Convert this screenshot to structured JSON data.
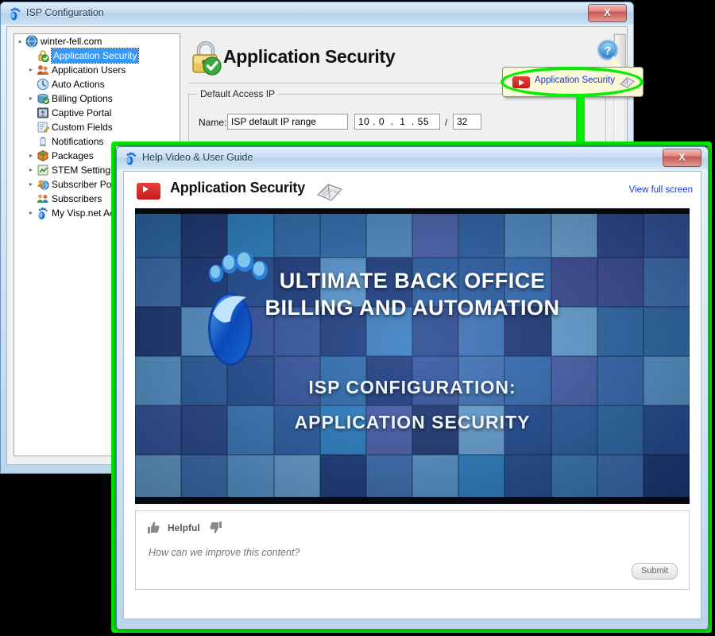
{
  "main_window": {
    "title": "ISP Configuration",
    "icon": "footprint-icon",
    "close_label": "X",
    "tree": [
      {
        "label": "winter-fell.com",
        "icon": "globe-icon",
        "indent": 0,
        "arrow": "▴",
        "selected": false
      },
      {
        "label": "Application Security",
        "icon": "lock-check-icon",
        "indent": 1,
        "arrow": "",
        "selected": true
      },
      {
        "label": "Application Users",
        "icon": "users-icon",
        "indent": 1,
        "arrow": "▸",
        "selected": false
      },
      {
        "label": "Auto Actions",
        "icon": "clock-icon",
        "indent": 1,
        "arrow": "",
        "selected": false
      },
      {
        "label": "Billing Options",
        "icon": "billing-icon",
        "indent": 1,
        "arrow": "▸",
        "selected": false
      },
      {
        "label": "Captive Portal",
        "icon": "portal-icon",
        "indent": 1,
        "arrow": "",
        "selected": false
      },
      {
        "label": "Custom Fields",
        "icon": "pencil-note-icon",
        "indent": 1,
        "arrow": "",
        "selected": false
      },
      {
        "label": "Notifications",
        "icon": "bell-icon",
        "indent": 1,
        "arrow": "",
        "selected": false
      },
      {
        "label": "Packages",
        "icon": "package-icon",
        "indent": 1,
        "arrow": "▸",
        "selected": false
      },
      {
        "label": "STEM Settings",
        "icon": "stem-icon",
        "indent": 1,
        "arrow": "▸",
        "selected": false
      },
      {
        "label": "Subscriber Portal",
        "icon": "subscriber-portal-icon",
        "indent": 1,
        "arrow": "▸",
        "selected": false
      },
      {
        "label": "Subscribers",
        "icon": "subscribers-icon",
        "indent": 1,
        "arrow": "",
        "selected": false
      },
      {
        "label": "My Visp.net Account",
        "icon": "footprint-icon",
        "indent": 1,
        "arrow": "▸",
        "selected": false
      }
    ],
    "page": {
      "title": "Application Security",
      "icon": "lock-check-large-icon",
      "group_legend": "Default Access IP",
      "name_label": "Name:",
      "name_value": "ISP default IP range",
      "ip_value": "10 . 0  .  1  . 55",
      "slash": "/",
      "cidr_value": "32"
    },
    "help_button_icon": "help-question-icon",
    "tooltip": {
      "link_text": "Application Security",
      "video_icon": "youtube-play-icon",
      "guide_icon": "book-icon"
    }
  },
  "help_dialog": {
    "title": "Help Video & User Guide",
    "icon": "footprint-icon",
    "close_label": "X",
    "video_title": "Application Security",
    "video_icon": "youtube-play-icon",
    "guide_icon": "book-icon",
    "fullscreen_link": "View full screen",
    "video_slide": {
      "line1": "ULTIMATE BACK OFFICE",
      "line2": "BILLING AND AUTOMATION",
      "line3": "ISP CONFIGURATION:",
      "line4": "APPLICATION SECURITY",
      "logo": "footprint-logo"
    },
    "feedback": {
      "helpful_label": "Helpful",
      "thumb_up_icon": "thumbs-up-icon",
      "thumb_down_icon": "thumbs-down-icon",
      "placeholder": "How can we improve this content?",
      "submit_label": "Submit"
    }
  },
  "annotations": {
    "highlight_color": "#00ee00",
    "ellipse_target": "tooltip-application-security",
    "frame_target": "help-dialog"
  }
}
